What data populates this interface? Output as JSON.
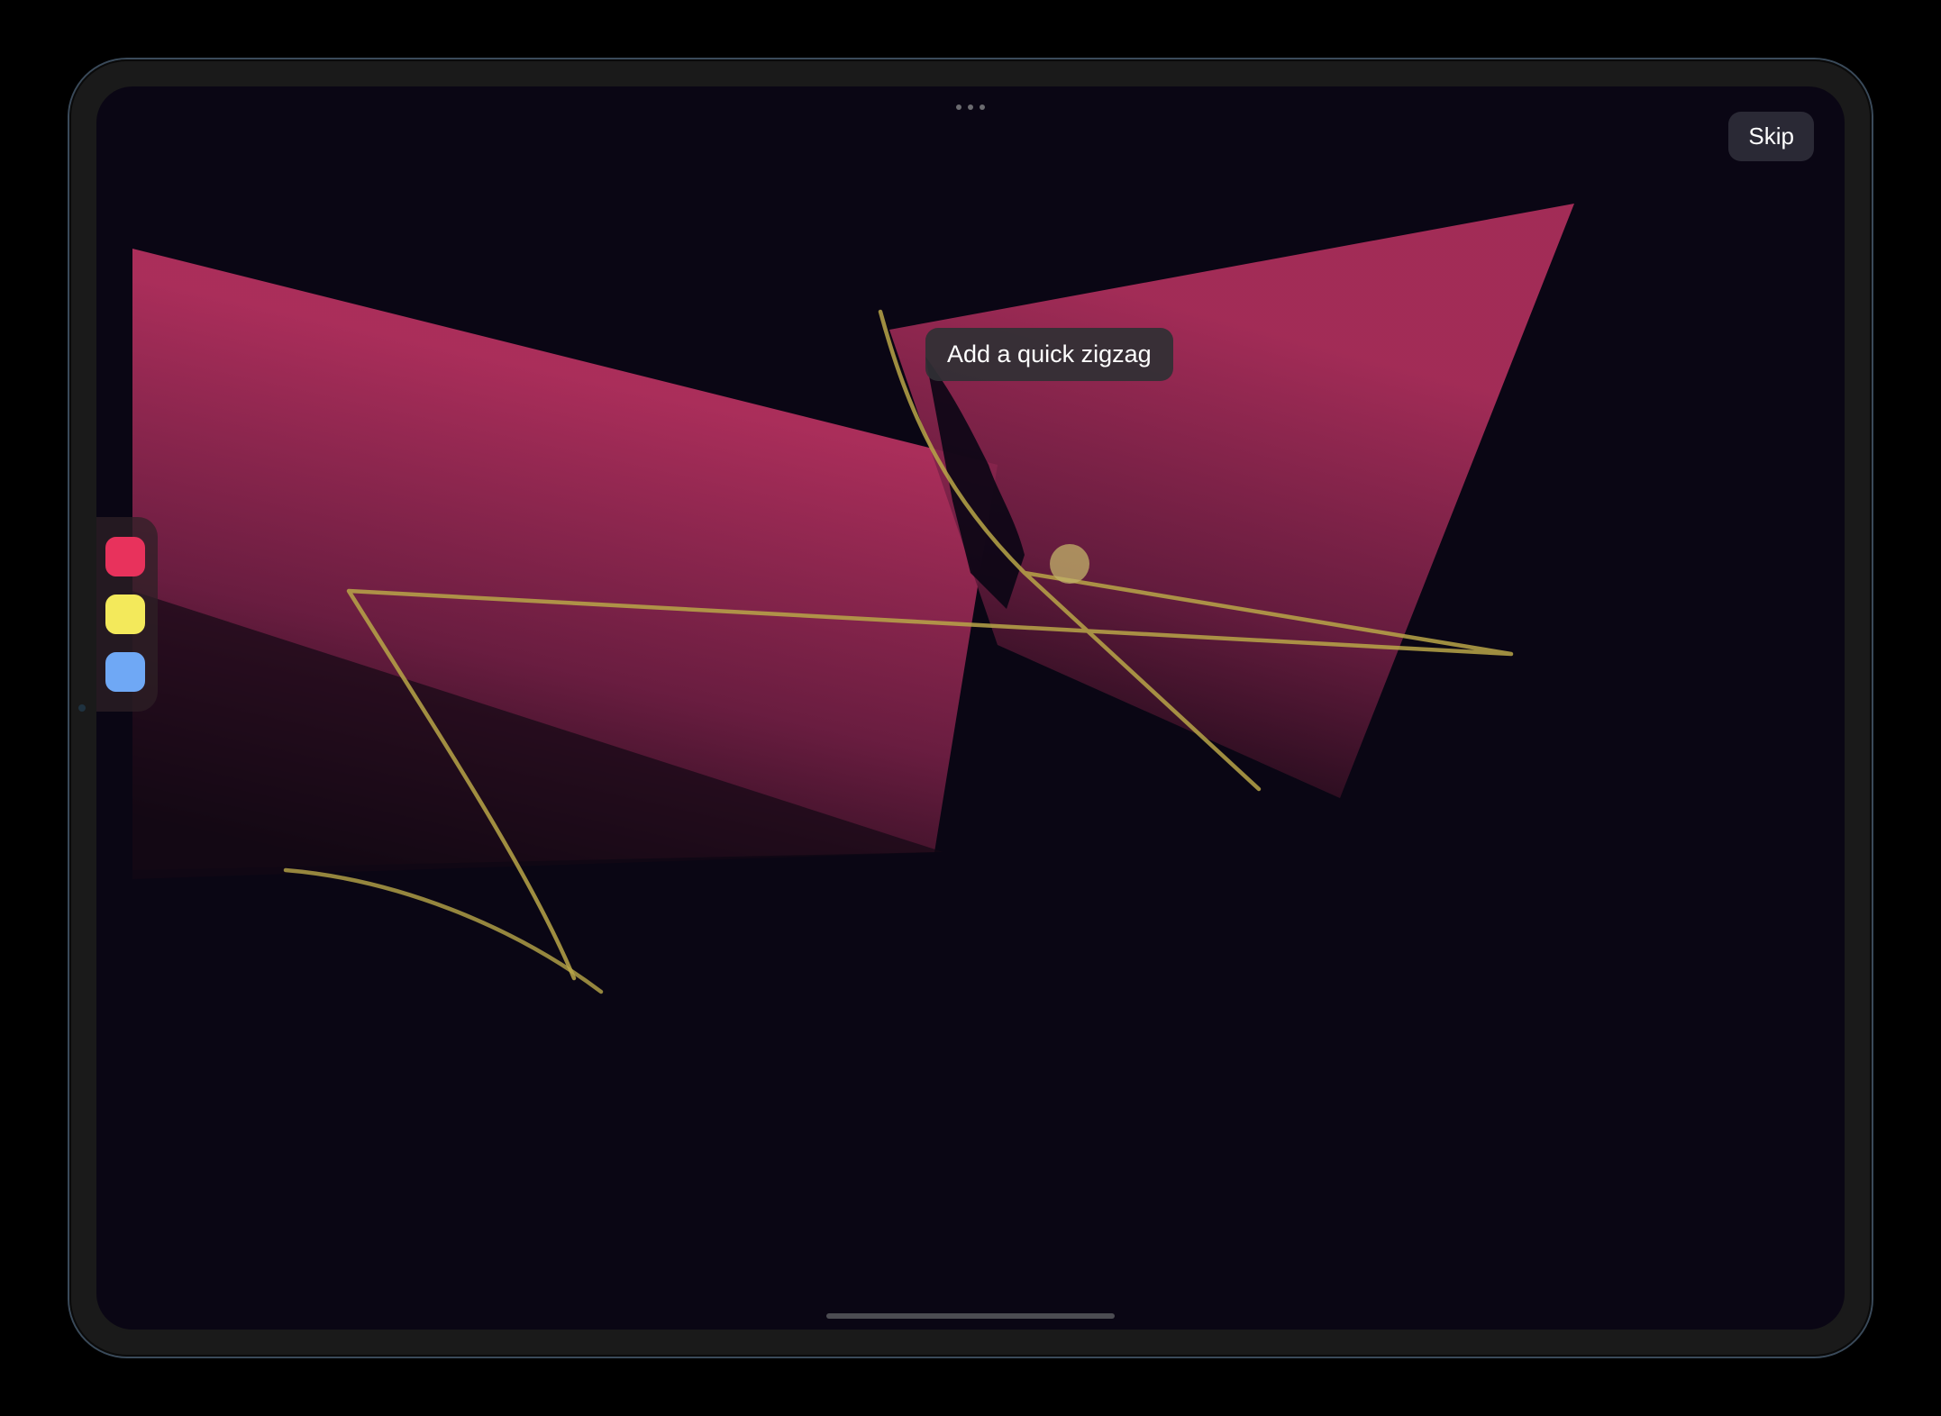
{
  "header": {
    "skip_label": "Skip"
  },
  "tooltip": {
    "text": "Add a quick zigzag"
  },
  "palette": {
    "colors": [
      {
        "name": "pink",
        "hex": "#E8325C"
      },
      {
        "name": "yellow",
        "hex": "#F3E95B"
      },
      {
        "name": "blue",
        "hex": "#6FA8F5"
      }
    ]
  },
  "canvas": {
    "background": "#0A0614",
    "stroke_color": "#B8A648",
    "active_dot_color": "#C2B36A",
    "shape_gradient_from": "#B3305E",
    "shape_gradient_to": "#120816"
  }
}
